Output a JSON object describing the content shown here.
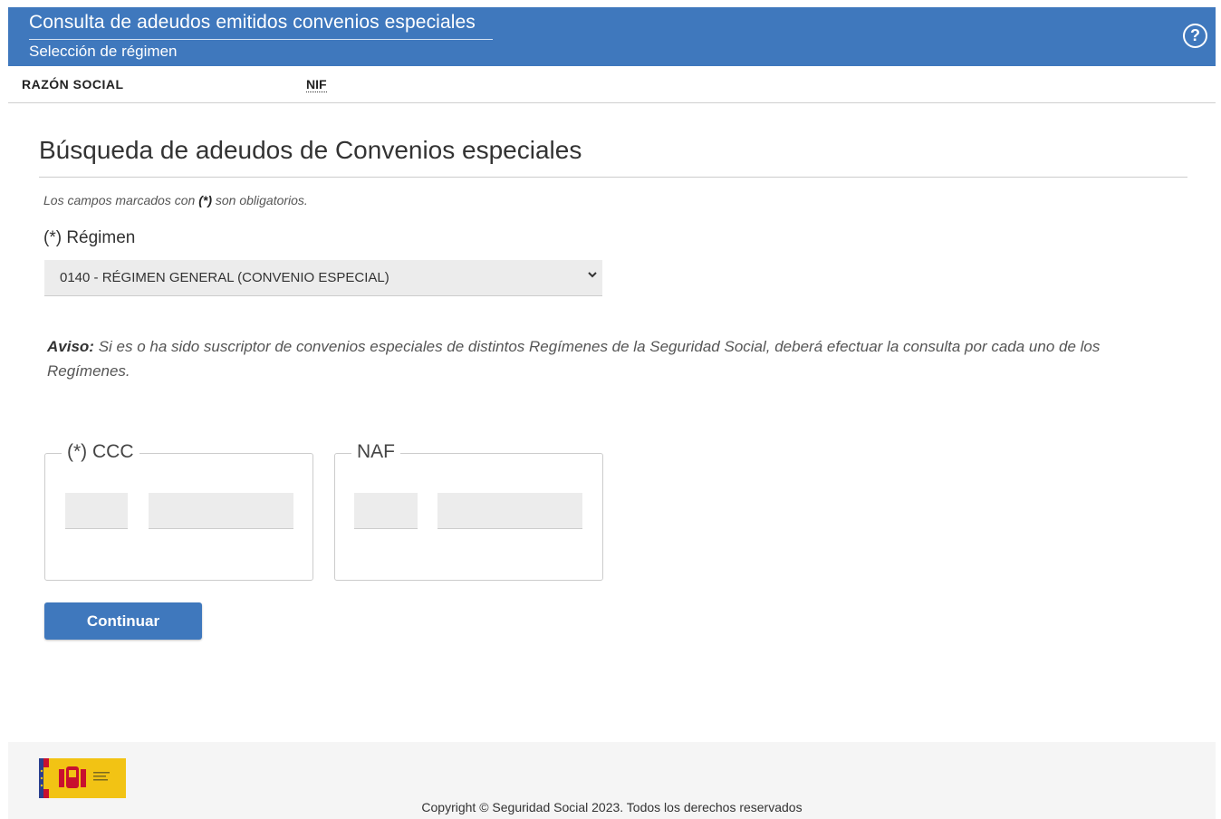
{
  "header": {
    "title": "Consulta de adeudos emitidos convenios especiales",
    "subtitle": "Selección de régimen",
    "help_icon": "question-circle-icon",
    "help_symbol": "?"
  },
  "infobar": {
    "razon_social_label": "RAZÓN SOCIAL",
    "nif_label": "NIF"
  },
  "main": {
    "title": "Búsqueda de adeudos de Convenios especiales",
    "required_note": {
      "prefix": "Los campos marcados con ",
      "marker": "(*)",
      "suffix": " son obligatorios."
    },
    "regimen": {
      "label": "(*) Régimen",
      "selected": "0140 - RÉGIMEN GENERAL (CONVENIO ESPECIAL)"
    },
    "aviso": {
      "label": "Aviso:",
      "text": " Si es o ha sido suscriptor de convenios especiales de distintos Regímenes de la Seguridad Social, deberá efectuar la consulta por cada uno de los Regímenes."
    },
    "ccc": {
      "legend": "(*) CCC",
      "part1": "",
      "part2": ""
    },
    "naf": {
      "legend": "NAF",
      "part1": "",
      "part2": ""
    },
    "continue_label": "Continuar"
  },
  "footer": {
    "logo_icon": "gobierno-de-espana-logo",
    "copyright": "Copyright © Seguridad Social 2023. Todos los derechos reservados"
  },
  "colors": {
    "header_bg": "#3f78bd",
    "button_bg": "#3f78bd",
    "input_bg": "#ececec",
    "footer_bg": "#f5f5f5"
  }
}
